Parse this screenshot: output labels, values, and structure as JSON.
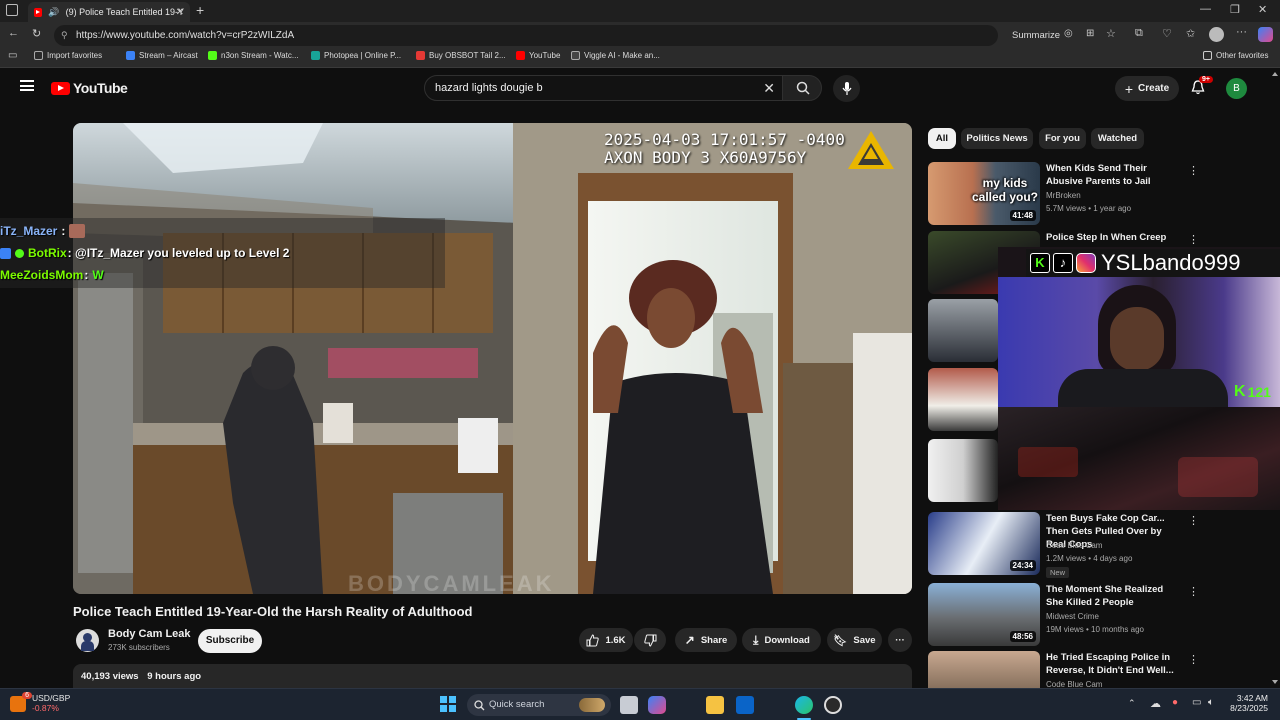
{
  "browser": {
    "tab_title": "(9) Police Teach Entitled 19-Y",
    "url": "https://www.youtube.com/watch?v=crP2zWILZdA",
    "summarize": "Summarize",
    "bookmarks": [
      {
        "label": "Import favorites",
        "color": "#8ab4f8"
      },
      {
        "label": "Stream – Aircast",
        "color": "#3b82f6"
      },
      {
        "label": "n3on Stream - Watc...",
        "color": "#53fc18"
      },
      {
        "label": "Photopea | Online P...",
        "color": "#18a497"
      },
      {
        "label": "Buy OBSBOT Tail 2...",
        "color": "#e53935"
      },
      {
        "label": "YouTube",
        "color": "#ff0000"
      },
      {
        "label": "Viggle AI - Make an...",
        "color": "#444444"
      }
    ],
    "other_favorites": "Other favorites"
  },
  "youtube": {
    "logo": "YouTube",
    "search_value": "hazard lights dougie b",
    "create": "Create",
    "notif_count": "9+",
    "avatar_letter": "B"
  },
  "video": {
    "timestamp_line1": "2025-04-03 17:01:57 -0400",
    "timestamp_line2": "AXON BODY 3 X60A9756Y",
    "watermark": "BODYCAMLEAK",
    "title": "Police Teach Entitled 19-Year-Old the Harsh Reality of Adulthood",
    "channel": "Body Cam Leak",
    "subscribers": "273K subscribers",
    "subscribe": "Subscribe",
    "likes": "1.6K",
    "share": "Share",
    "download": "Download",
    "save": "Save",
    "views": "40,193 views",
    "age": "9 hours ago"
  },
  "chat": [
    {
      "user": "iTz_Mazer",
      "text": "",
      "color": "#8ab4f8"
    },
    {
      "user": "BotRix",
      "text": ": @ITz_Mazer you leveled up to Level 2",
      "color": "#7cfc00"
    },
    {
      "user": "MeeZoidsMom",
      "text": " :",
      "color": "#7cfc00"
    }
  ],
  "chips": [
    "All",
    "Politics News",
    "For you",
    "Watched"
  ],
  "recs": [
    {
      "title": "When Kids Send Their Abusive Parents to Jail",
      "channel": "MrBroken",
      "meta": "5.7M views • 1 year ago",
      "duration": "41:48",
      "thumb_text": "my kids called you?"
    },
    {
      "title": "Police Step In When Creep",
      "channel": "",
      "meta": "",
      "duration": ""
    },
    {
      "title": "Teen Buys Fake Cop Car... Then Gets Pulled Over by Real Cops",
      "channel": "Code Blue Cam",
      "meta": "1.2M views • 4 days ago",
      "duration": "24:34",
      "badge": "New"
    },
    {
      "title": "The Moment She Realized She Killed 2 People",
      "channel": "Midwest Crime",
      "meta": "19M views • 10 months ago",
      "duration": "48:56"
    },
    {
      "title": "He Tried Escaping Police in Reverse, It Didn't End Well...",
      "channel": "Code Blue Cam",
      "meta": "",
      "duration": ""
    }
  ],
  "stream_overlay": {
    "handle": "YSLbando999",
    "viewers": "121"
  },
  "taskbar": {
    "ticker": "USD/GBP",
    "change": "-0.87%",
    "ticker_badge": "6",
    "search": "Quick search",
    "time": "3:42 AM",
    "date": "8/23/2025"
  }
}
